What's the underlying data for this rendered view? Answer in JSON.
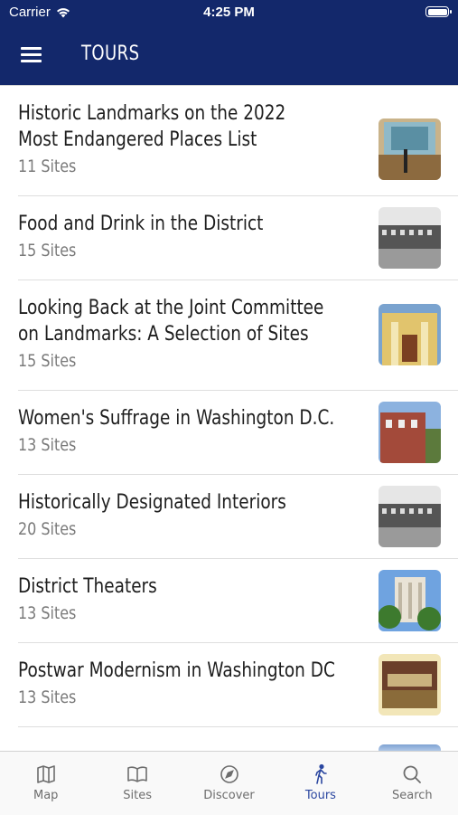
{
  "status_bar": {
    "carrier": "Carrier",
    "time": "4:25 PM"
  },
  "header": {
    "title": "TOURS"
  },
  "tours": [
    {
      "title": "Historic Landmarks on the 2022 Most Endangered Places List",
      "count": "11 Sites"
    },
    {
      "title": "Food and Drink in the District",
      "count": "15 Sites"
    },
    {
      "title": "Looking Back at the Joint Committee on Landmarks: A Selection of Sites",
      "count": "15 Sites"
    },
    {
      "title": "Women's Suffrage in Washington D.C.",
      "count": "13 Sites"
    },
    {
      "title": "Historically Designated Interiors",
      "count": "20 Sites"
    },
    {
      "title": "District Theaters",
      "count": "13 Sites"
    },
    {
      "title": "Postwar Modernism in Washington DC",
      "count": "13 Sites"
    }
  ],
  "tabbar": {
    "items": [
      {
        "label": "Map",
        "icon": "map-icon"
      },
      {
        "label": "Sites",
        "icon": "book-icon"
      },
      {
        "label": "Discover",
        "icon": "compass-icon"
      },
      {
        "label": "Tours",
        "icon": "walking-person-icon"
      },
      {
        "label": "Search",
        "icon": "search-icon"
      }
    ],
    "active": "Tours"
  },
  "colors": {
    "header_bg": "#13286b",
    "active_tab": "#2b47a0",
    "inactive_tab": "#6d6d6d"
  }
}
